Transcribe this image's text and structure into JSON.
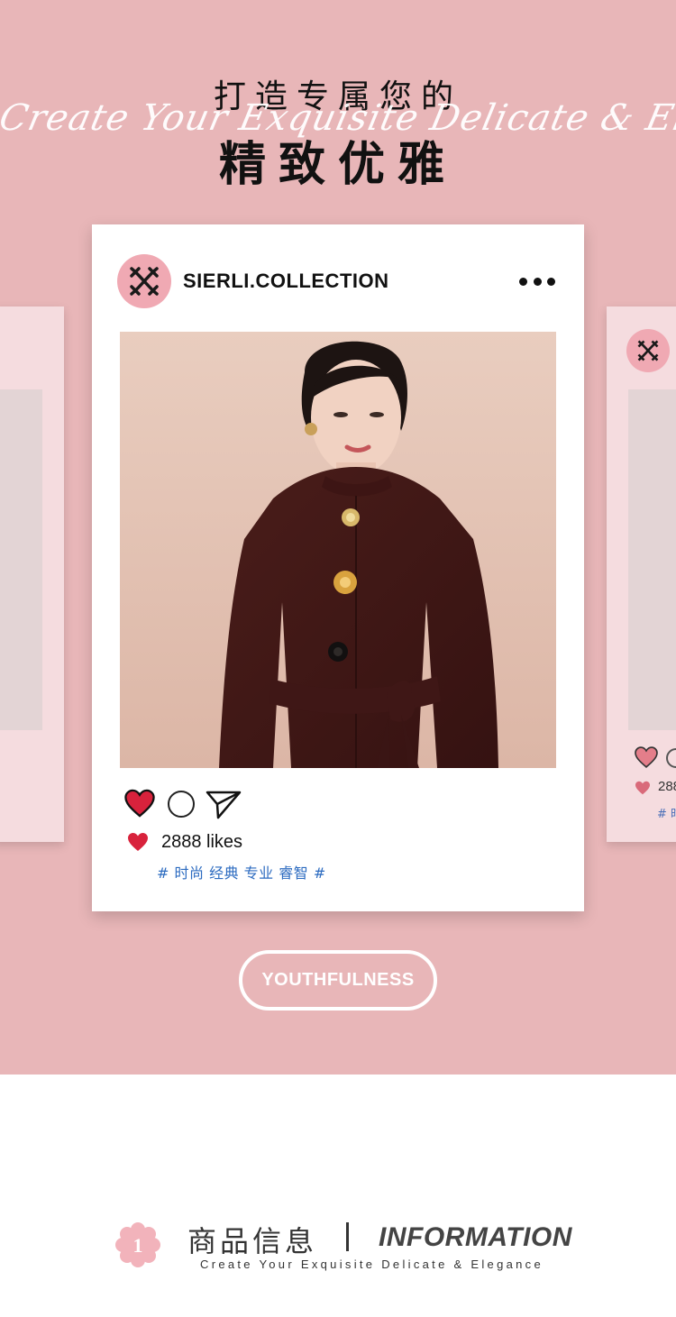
{
  "hero": {
    "title_line1": "打造专属您的",
    "script_text": "Create Your Exquisite Delicate & Elegance",
    "title_line2": "精致优雅"
  },
  "post": {
    "account_name": "SIERLI.COLLECTION",
    "more_icon": "more-dots-icon",
    "likes_text": "2888 likes",
    "hashtags": "# 时尚 经典 专业 睿智 #",
    "actions": [
      "heart-icon",
      "comment-icon",
      "share-icon"
    ]
  },
  "side_post": {
    "likes_text": "288",
    "hashtag_fragment": "# 时"
  },
  "pill_label": "YOUTHFULNESS",
  "info": {
    "number": "1",
    "title_cn": "商品信息",
    "title_en": "INFORMATION",
    "subtitle": "Create Your Exquisite Delicate & Elegance"
  },
  "colors": {
    "background_pink": "#e8b6b8",
    "avatar_pink": "#f0a9b3",
    "heart_red": "#d8223c",
    "hashtag_blue": "#2c6bc0"
  }
}
